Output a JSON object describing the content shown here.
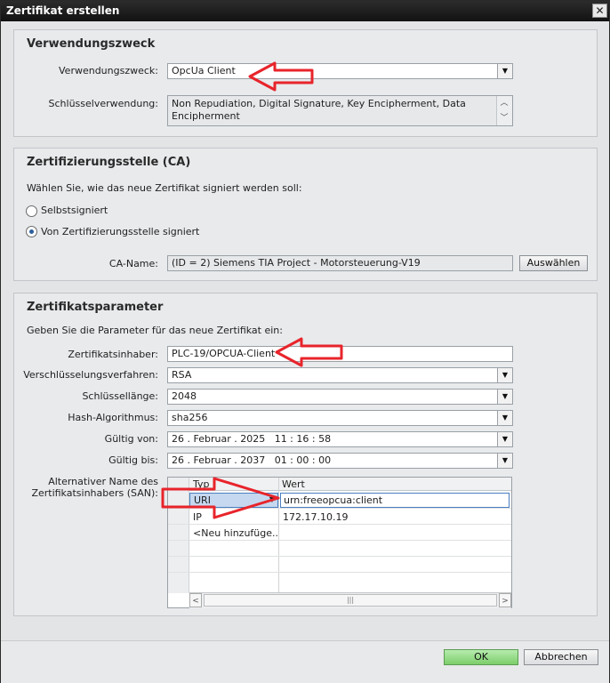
{
  "window": {
    "title": "Zertifikat erstellen",
    "close_glyph": "✕"
  },
  "usage": {
    "heading": "Verwendungszweck",
    "purpose_label": "Verwendungszweck:",
    "purpose_value": "OpcUa Client",
    "keyusage_label": "Schlüsselverwendung:",
    "keyusage_value": "Non Repudiation, Digital Signature, Key Encipherment, Data Encipherment"
  },
  "ca": {
    "heading": "Zertifizierungsstelle (CA)",
    "prompt": "Wählen Sie, wie das neue Zertifikat signiert werden soll:",
    "option_self": "Selbstsigniert",
    "option_ca": "Von Zertifizierungsstelle signiert",
    "selected": "ca",
    "ca_name_label": "CA-Name:",
    "ca_name_value": "(ID = 2) Siemens TIA Project - Motorsteuerung-V19",
    "select_button": "Auswählen"
  },
  "params": {
    "heading": "Zertifikatsparameter",
    "prompt": "Geben Sie die Parameter für das neue Zertifikat ein:",
    "holder_label": "Zertifikatsinhaber:",
    "holder_value": "PLC-19/OPCUA-Client",
    "encryption_label": "Verschlüsselungsverfahren:",
    "encryption_value": "RSA",
    "keylength_label": "Schlüssellänge:",
    "keylength_value": "2048",
    "hash_label": "Hash-Algorithmus:",
    "hash_value": "sha256",
    "valid_from_label": "Gültig von:",
    "valid_from_value": "26 . Februar . 2025   11 : 16 : 58",
    "valid_to_label": "Gültig bis:",
    "valid_to_value": "26 . Februar . 2037   01 : 00 : 00",
    "san_label": "Alternativer Name des Zertifikatsinhabers (SAN):",
    "san_table": {
      "columns": [
        "Typ",
        "Wert"
      ],
      "rows": [
        {
          "type": "URI",
          "value": "urn:freeopcua:client"
        },
        {
          "type": "IP",
          "value": "172.17.10.19"
        },
        {
          "type": "<Neu hinzufüge...",
          "value": ""
        }
      ],
      "scroll_thumb_glyph": "|||"
    }
  },
  "footer": {
    "ok": "OK",
    "cancel": "Abbrechen"
  },
  "colors": {
    "annotation_arrow": "#e8242b",
    "ok_button": "#8fd47f",
    "selection": "#c5d8f0"
  },
  "icons": {
    "dropdown": "chevron-down-icon",
    "scroll_up": "scroll-up-icon",
    "scroll_down": "scroll-down-icon"
  }
}
